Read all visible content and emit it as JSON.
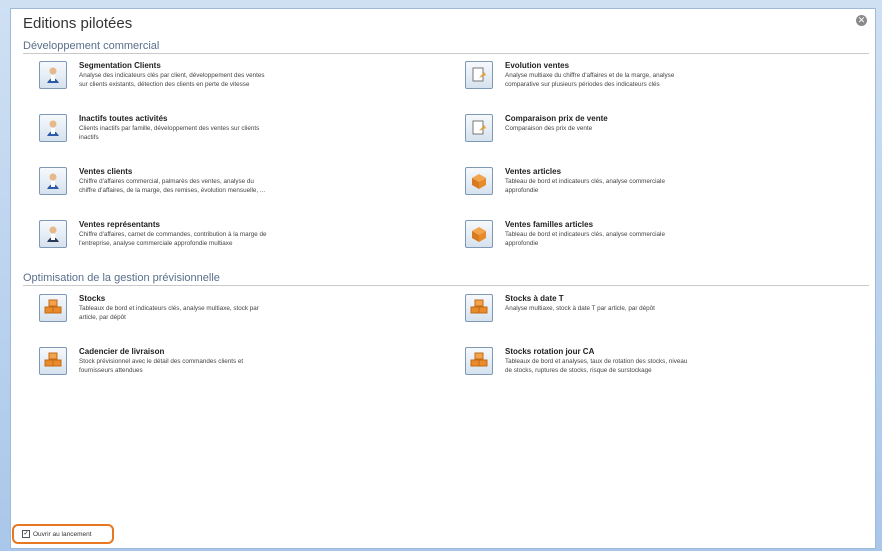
{
  "window": {
    "title": "Editions pilotées"
  },
  "sections": [
    {
      "label": "Développement commercial"
    },
    {
      "label": "Optimisation de la gestion prévisionnelle"
    }
  ],
  "items": [
    {
      "title": "Segmentation Clients",
      "desc": "Analyse des indicateurs clés par client, développement des ventes sur clients existants, détection des clients en perte de vitesse",
      "icon": "person-icon"
    },
    {
      "title": "Evolution ventes",
      "desc": "Analyse multiaxe du chiffre d'affaires et de la marge, analyse comparative sur plusieurs périodes des indicateurs clés",
      "icon": "document-icon"
    },
    {
      "title": "Inactifs toutes activités",
      "desc": "Clients inactifs par famille, développement des ventes sur clients inactifs",
      "icon": "person-icon"
    },
    {
      "title": "Comparaison prix de vente",
      "desc": "Comparaison des prix de vente",
      "icon": "document-icon"
    },
    {
      "title": "Ventes clients",
      "desc": "Chiffre d'affaires commercial, palmarès des ventes, analyse du chiffre d'affaires, de la marge, des remises, évolution mensuelle, ...",
      "icon": "person-icon"
    },
    {
      "title": "Ventes articles",
      "desc": "Tableau de bord et indicateurs clés, analyse commerciale approfondie",
      "icon": "box-icon"
    },
    {
      "title": "Ventes représentants",
      "desc": "Chiffre d'affaires, carnet de commandes, contribution à la marge de l'entreprise, analyse commerciale approfondie multiaxe",
      "icon": "person-icon"
    },
    {
      "title": "Ventes familles articles",
      "desc": "Tableau de bord et indicateurs clés, analyse commerciale approfondie",
      "icon": "box-icon"
    },
    {
      "title": "Stocks",
      "desc": "Tableaux de bord et indicateurs clés, analyse multiaxe, stock par article, par dépôt",
      "icon": "boxes-icon"
    },
    {
      "title": "Stocks à date T",
      "desc": "Analyse multiaxe, stock à date T par article, par dépôt",
      "icon": "boxes-icon"
    },
    {
      "title": "Cadencier de livraison",
      "desc": "Stock prévisionnel avec le détail des commandes clients et fournisseurs attendues",
      "icon": "boxes-icon"
    },
    {
      "title": "Stocks rotation jour CA",
      "desc": "Tableaux de bord et analyses, taux de rotation des stocks, niveau de stocks, ruptures de stocks, risque de surstockage",
      "icon": "boxes-icon"
    }
  ],
  "footer": {
    "checkbox_label": "Ouvrir au lancement",
    "checked": true
  }
}
